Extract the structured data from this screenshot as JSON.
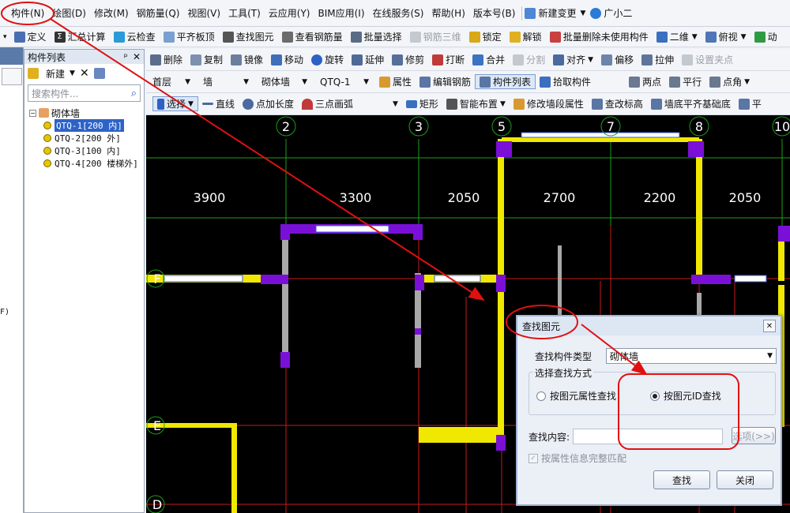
{
  "menubar": {
    "items": [
      "构件(N)",
      "绘图(D)",
      "修改(M)",
      "钢筋量(Q)",
      "视图(V)",
      "工具(T)",
      "云应用(Y)",
      "BIM应用(I)",
      "在线服务(S)",
      "帮助(H)",
      "版本号(B)",
      "新建变更",
      "广小二"
    ]
  },
  "toolbar1": {
    "items": [
      "定义",
      "汇总计算",
      "云检查",
      "平齐板顶",
      "查找图元",
      "查看钢筋量",
      "批量选择",
      "钢筋三维",
      "锁定",
      "解锁",
      "批量删除未使用构件",
      "二维",
      "俯视",
      "动"
    ]
  },
  "component_list": {
    "title": "构件列表",
    "new_label": "新建",
    "search_placeholder": "搜索构件...",
    "root": "砌体墙",
    "children": [
      "QTQ-1[200 内]",
      "QTQ-2[200 外]",
      "QTQ-3[100 内]",
      "QTQ-4[200 楼梯外]"
    ]
  },
  "left_note": "F)",
  "edit_toolbar": {
    "items": [
      "删除",
      "复制",
      "镜像",
      "移动",
      "旋转",
      "延伸",
      "修剪",
      "打断",
      "合并",
      "分割",
      "对齐",
      "偏移",
      "拉伸",
      "设置夹点"
    ]
  },
  "property_toolbar": {
    "floor": "首层",
    "category": "墙",
    "type": "砌体墙",
    "component": "QTQ-1",
    "items": [
      "属性",
      "编辑钢筋",
      "构件列表",
      "拾取构件",
      "两点",
      "平行",
      "点角"
    ]
  },
  "draw_toolbar": {
    "items": [
      "选择",
      "直线",
      "点加长度",
      "三点画弧",
      "矩形",
      "智能布置",
      "修改墙段属性",
      "查改标高",
      "墙底平齐基础底",
      "平"
    ]
  },
  "canvas": {
    "axis_numbers": [
      "2",
      "3",
      "5",
      "7",
      "8",
      "10"
    ],
    "row_labels": [
      "F",
      "E",
      "D"
    ],
    "dimensions": [
      "3900",
      "3300",
      "2050",
      "2700",
      "2200",
      "2050"
    ]
  },
  "dialog": {
    "title": "查找图元",
    "type_label": "查找构件类型",
    "type_value": "砌体墙",
    "method_legend": "选择查找方式",
    "option_attr": "按图元属性查找",
    "option_id": "按图元ID查找",
    "content_label": "查找内容:",
    "options_button": "选项(>>)",
    "match_label": "按属性信息完整匹配",
    "find_button": "查找",
    "close_button": "关闭"
  }
}
